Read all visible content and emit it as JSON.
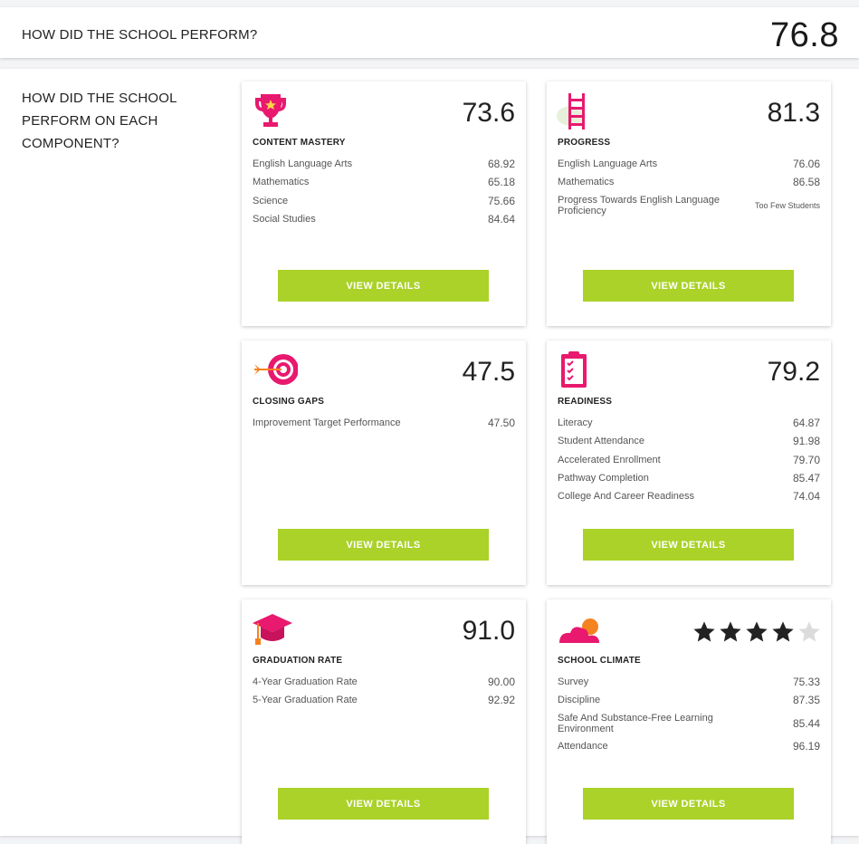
{
  "header": {
    "question": "HOW DID THE SCHOOL PERFORM?",
    "score": "76.8"
  },
  "components_question": "HOW DID THE SCHOOL PERFORM ON EACH COMPONENT?",
  "button_label": "VIEW DETAILS",
  "colors": {
    "accent": "#aad228",
    "icon_pink": "#e8196e",
    "icon_orange": "#f58220"
  },
  "cards": {
    "content": {
      "icon": "trophy-icon",
      "score": "73.6",
      "title": "CONTENT MASTERY",
      "rows": [
        {
          "label": "English Language Arts",
          "value": "68.92"
        },
        {
          "label": "Mathematics",
          "value": "65.18"
        },
        {
          "label": "Science",
          "value": "75.66"
        },
        {
          "label": "Social Studies",
          "value": "84.64"
        }
      ]
    },
    "progress": {
      "icon": "ladder-icon",
      "score": "81.3",
      "title": "PROGRESS",
      "rows": [
        {
          "label": "English Language Arts",
          "value": "76.06"
        },
        {
          "label": "Mathematics",
          "value": "86.58"
        },
        {
          "label": "Progress Towards English Language Proficiency",
          "value": "Too Few Students"
        }
      ]
    },
    "gaps": {
      "icon": "target-icon",
      "score": "47.5",
      "title": "CLOSING GAPS",
      "rows": [
        {
          "label": "Improvement Target Performance",
          "value": "47.50"
        }
      ]
    },
    "readiness": {
      "icon": "clipboard-icon",
      "score": "79.2",
      "title": "READINESS",
      "rows": [
        {
          "label": "Literacy",
          "value": "64.87"
        },
        {
          "label": "Student Attendance",
          "value": "91.98"
        },
        {
          "label": "Accelerated Enrollment",
          "value": "79.70"
        },
        {
          "label": "Pathway Completion",
          "value": "85.47"
        },
        {
          "label": "College And Career Readiness",
          "value": "74.04"
        }
      ]
    },
    "graduation": {
      "icon": "graduation-cap-icon",
      "score": "91.0",
      "title": "GRADUATION RATE",
      "rows": [
        {
          "label": "4-Year Graduation Rate",
          "value": "90.00"
        },
        {
          "label": "5-Year Graduation Rate",
          "value": "92.92"
        }
      ]
    },
    "climate": {
      "icon": "sunset-icon",
      "stars": 4,
      "stars_max": 5,
      "title": "SCHOOL CLIMATE",
      "rows": [
        {
          "label": "Survey",
          "value": "75.33"
        },
        {
          "label": "Discipline",
          "value": "87.35"
        },
        {
          "label": "Safe And Substance-Free Learning Environment",
          "value": "85.44"
        },
        {
          "label": "Attendance",
          "value": "96.19"
        }
      ]
    }
  }
}
